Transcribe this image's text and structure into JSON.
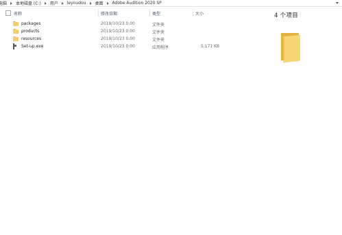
{
  "address_bar": {
    "crumbs": [
      "电脑",
      "本地磁盘 (C:)",
      "用户",
      "leyoudou",
      "桌面",
      "Adobe Audition 2020 SP"
    ]
  },
  "columns": {
    "name": "名称",
    "modified": "修改日期",
    "type": "类型",
    "size": "大小"
  },
  "files": [
    {
      "name": "packages",
      "modified": "2019/10/23 0:00",
      "type": "文件夹",
      "size": "",
      "icon": "folder-icon"
    },
    {
      "name": "products",
      "modified": "2019/10/23 0:00",
      "type": "文件夹",
      "size": "",
      "icon": "folder-icon"
    },
    {
      "name": "resources",
      "modified": "2019/10/23 0:00",
      "type": "文件夹",
      "size": "",
      "icon": "folder-icon"
    },
    {
      "name": "Set-up.exe",
      "modified": "2019/10/23 0:00",
      "type": "应用程序",
      "size": "5,171 KB",
      "icon": "exe-icon"
    }
  ],
  "details_pane": {
    "item_count": "4 个项目",
    "icon": "folder-icon"
  },
  "colors": {
    "folder": "#f5cf6a",
    "folder_dark": "#e6b23f",
    "header_text": "#4a5a6a"
  }
}
